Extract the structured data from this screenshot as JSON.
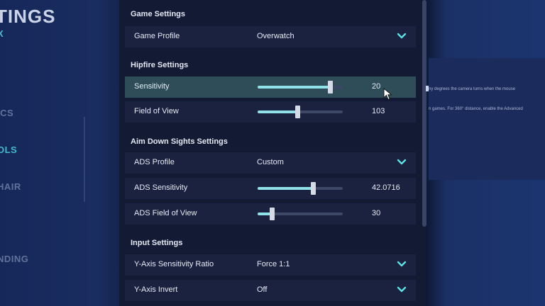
{
  "nav": {
    "title": "TINGS",
    "subtitle": "X",
    "items": [
      {
        "label": "ICS",
        "active": false
      },
      {
        "label": "OLS",
        "active": true
      },
      {
        "label": "HAIR",
        "active": false
      },
      {
        "label": "NDING",
        "active": false
      }
    ]
  },
  "sections": {
    "game": "Game Settings",
    "hipfire": "Hipfire Settings",
    "ads": "Aim Down Sights Settings",
    "input": "Input Settings"
  },
  "rows": {
    "game_profile": {
      "label": "Game Profile",
      "value": "Overwatch"
    },
    "sensitivity": {
      "label": "Sensitivity",
      "value": "20",
      "level": 0.85
    },
    "fov": {
      "label": "Field of View",
      "value": "103",
      "level": 0.47
    },
    "ads_profile": {
      "label": "ADS Profile",
      "value": "Custom"
    },
    "ads_sensitivity": {
      "label": "ADS Sensitivity",
      "value": "42.0716",
      "level": 0.65
    },
    "ads_fov": {
      "label": "ADS Field of View",
      "value": "30",
      "level": 0.17
    },
    "y_ratio": {
      "label": "Y-Axis Sensitivity Ratio",
      "value": "Force 1:1"
    },
    "y_invert": {
      "label": "Y-Axis Invert",
      "value": "Off"
    }
  },
  "info": {
    "line1": "ny degrees the camera turns when the mouse",
    "line2": "n games. For 360° distance, enable the Advanced"
  },
  "colors": {
    "accent": "#5ee0e6",
    "slider_fill": "#8fe3e8",
    "highlight_row": "#2e4d58"
  },
  "icons": {
    "dropdown": "chevron-down-icon",
    "cursor": "mouse-pointer-icon"
  }
}
